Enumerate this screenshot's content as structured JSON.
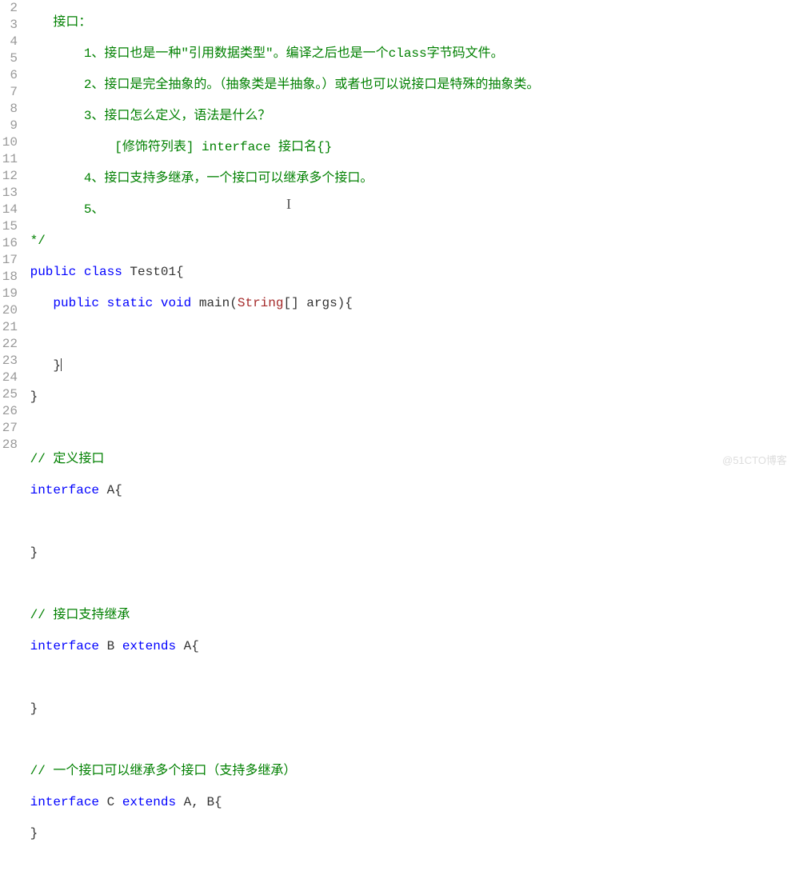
{
  "gutter": {
    "start": 2,
    "end": 28
  },
  "code": {
    "l2": "    接口：",
    "l3": "        1、接口也是一种\"引用数据类型\"。编译之后也是一个class字节码文件。",
    "l4": "        2、接口是完全抽象的。（抽象类是半抽象。）或者也可以说接口是特殊的抽象类。",
    "l5": "        3、接口怎么定义，语法是什么？",
    "l6": "            [修饰符列表] interface 接口名{}",
    "l7": "        4、接口支持多继承，一个接口可以继承多个接口。",
    "l8": "        5、",
    "l9": " */",
    "l10_a": " public",
    "l10_b": " class",
    "l10_c": " Test01{",
    "l11_a": "    public",
    "l11_b": " static",
    "l11_c": " void",
    "l11_d": " main(",
    "l11_e": "String",
    "l11_f": "[] args){",
    "l12": "",
    "l13": "    }",
    "l14": " }",
    "l15": "",
    "l16": " // 定义接口",
    "l17_a": " interface",
    "l17_b": " A{",
    "l18": "",
    "l19": " }",
    "l20": "",
    "l21": " // 接口支持继承",
    "l22_a": " interface",
    "l22_b": " B ",
    "l22_c": "extends",
    "l22_d": " A{",
    "l23": "",
    "l24": " }",
    "l25": "",
    "l26": " // 一个接口可以继承多个接口（支持多继承）",
    "l27_a": " interface",
    "l27_b": " C ",
    "l27_c": "extends",
    "l27_d": " A, B{",
    "l28": " }"
  },
  "watermark": "@51CTO博客"
}
